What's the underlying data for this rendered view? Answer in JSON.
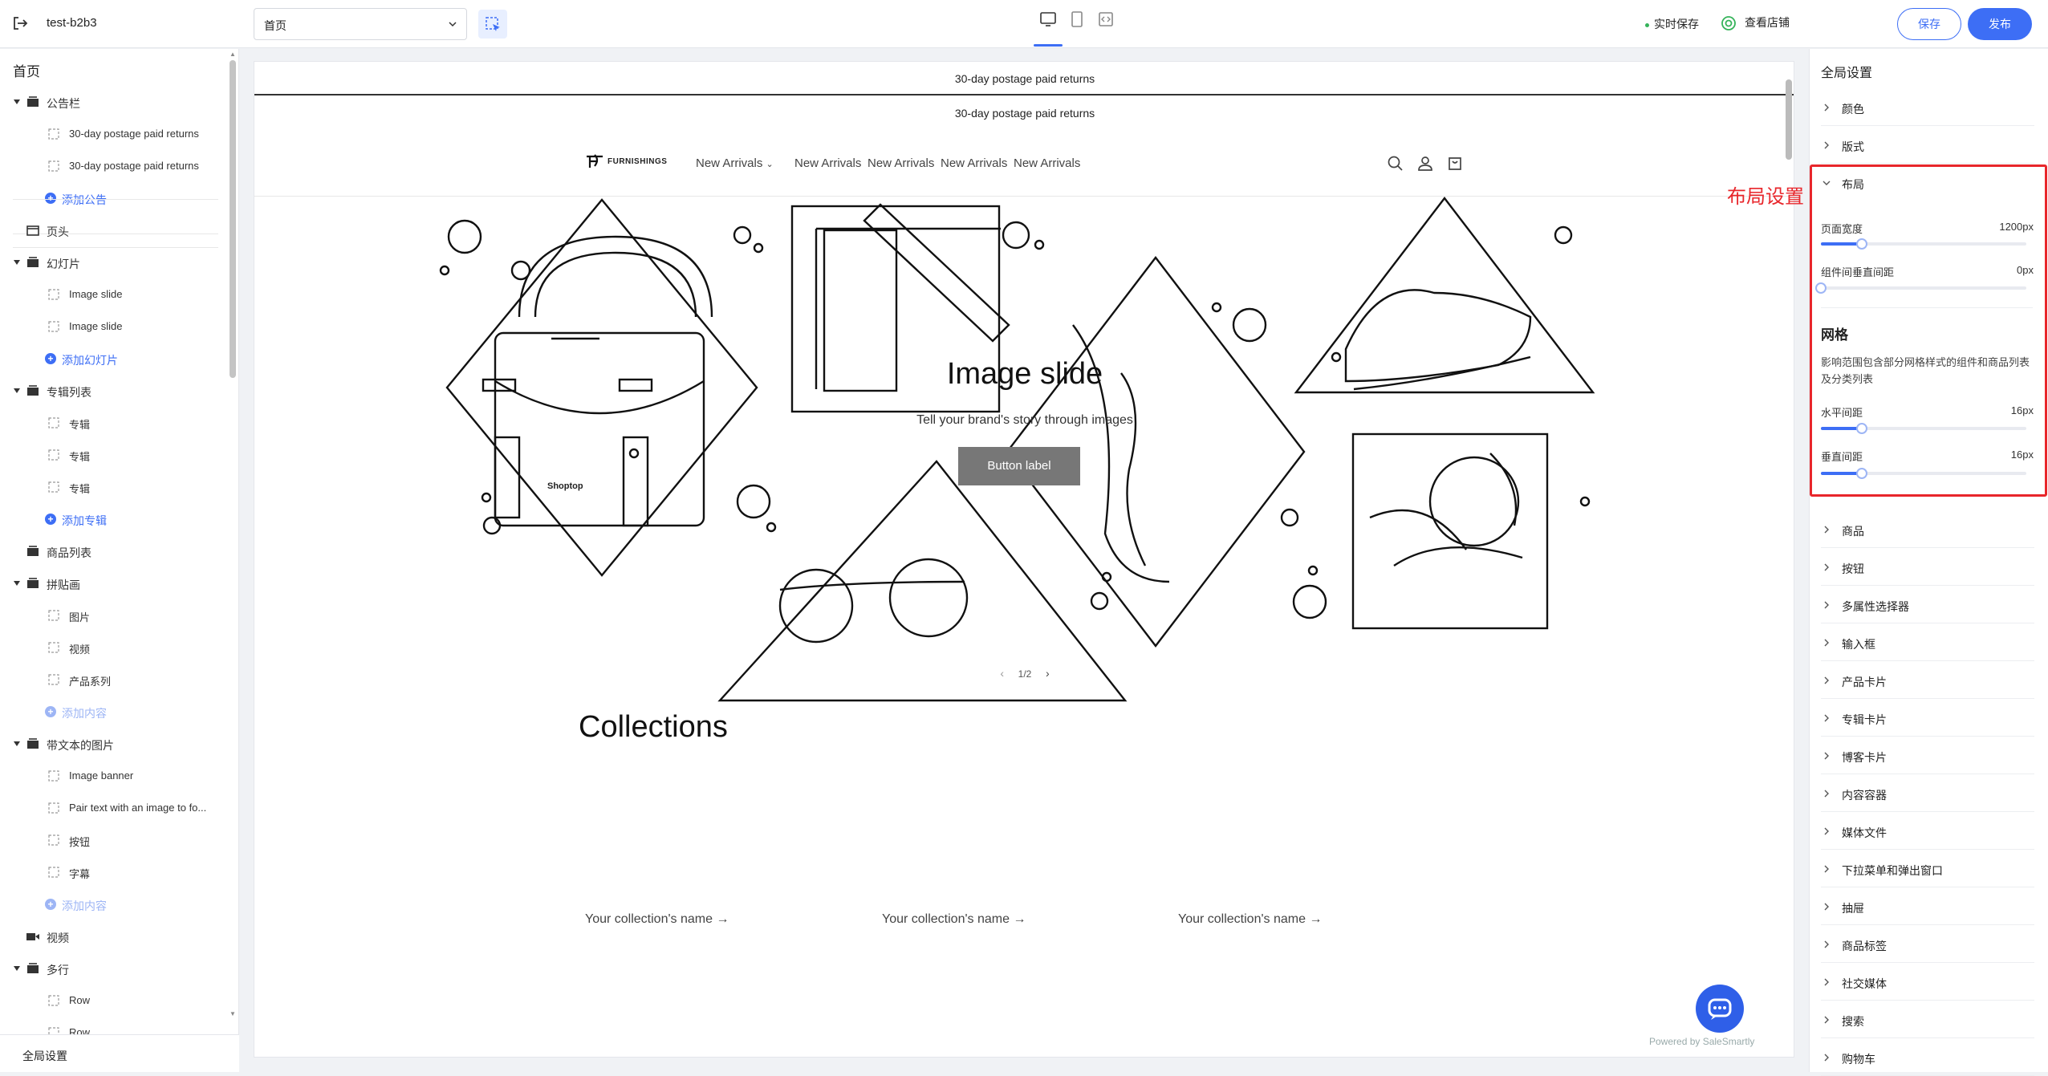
{
  "topbar": {
    "store_name": "test-b2b3",
    "page_select": "首页",
    "autosave": "实时保存",
    "view_store": "查看店铺",
    "save": "保存",
    "publish": "发布"
  },
  "left": {
    "title": "首页",
    "footer": "全局设置",
    "tree": [
      {
        "label": "公告栏",
        "type": "group"
      },
      {
        "label": "30-day postage paid returns",
        "type": "child"
      },
      {
        "label": "30-day postage paid returns",
        "type": "child"
      },
      {
        "label": "添加公告",
        "type": "add"
      },
      {
        "label": "页头",
        "type": "section"
      },
      {
        "label": "幻灯片",
        "type": "group"
      },
      {
        "label": "Image slide",
        "type": "child"
      },
      {
        "label": "Image slide",
        "type": "child"
      },
      {
        "label": "添加幻灯片",
        "type": "add"
      },
      {
        "label": "专辑列表",
        "type": "group"
      },
      {
        "label": "专辑",
        "type": "child"
      },
      {
        "label": "专辑",
        "type": "child"
      },
      {
        "label": "专辑",
        "type": "child"
      },
      {
        "label": "添加专辑",
        "type": "add"
      },
      {
        "label": "商品列表",
        "type": "section"
      },
      {
        "label": "拼贴画",
        "type": "group"
      },
      {
        "label": "图片",
        "type": "child"
      },
      {
        "label": "视频",
        "type": "child"
      },
      {
        "label": "产品系列",
        "type": "child"
      },
      {
        "label": "添加内容",
        "type": "add-disabled"
      },
      {
        "label": "带文本的图片",
        "type": "group"
      },
      {
        "label": "Image banner",
        "type": "child"
      },
      {
        "label": "Pair text with an image to fo...",
        "type": "child"
      },
      {
        "label": "按钮",
        "type": "child"
      },
      {
        "label": "字幕",
        "type": "child"
      },
      {
        "label": "添加内容",
        "type": "add-disabled"
      },
      {
        "label": "视频",
        "type": "section"
      },
      {
        "label": "多行",
        "type": "group"
      },
      {
        "label": "Row",
        "type": "child"
      },
      {
        "label": "Row",
        "type": "child"
      }
    ]
  },
  "canvas": {
    "announcement_1": "30-day postage paid returns",
    "announcement_2": "30-day postage paid returns",
    "logo_text": "FURNISHINGS",
    "nav": [
      "New Arrivals",
      "New Arrivals",
      "New Arrivals",
      "New Arrivals",
      "New Arrivals"
    ],
    "slide_title": "Image slide",
    "slide_subtitle": "Tell your brand's story through images",
    "slide_button": "Button label",
    "slide_pagination": "1/2",
    "bag_brand": "Shoptop",
    "collections_title": "Collections",
    "collection_names": [
      "Your collection's name →",
      "Your collection's name →",
      "Your collection's name →"
    ],
    "powered_by": "Powered by SaleSmartly"
  },
  "right": {
    "title": "全局设置",
    "sections_top": [
      "颜色",
      "版式"
    ],
    "layout_section": "布局",
    "page_width_label": "页面宽度",
    "page_width_value": "1200px",
    "page_width_level": 0.2,
    "component_gap_label": "组件间垂直间距",
    "component_gap_value": "0px",
    "component_gap_level": 0,
    "grid_heading": "网格",
    "grid_desc": "影响范围包含部分网格样式的组件和商品列表及分类列表",
    "h_gap_label": "水平间距",
    "h_gap_value": "16px",
    "h_gap_level": 0.2,
    "v_gap_label": "垂直间距",
    "v_gap_value": "16px",
    "v_gap_level": 0.2,
    "sections_bottom": [
      "商品",
      "按钮",
      "多属性选择器",
      "输入框",
      "产品卡片",
      "专辑卡片",
      "博客卡片",
      "内容容器",
      "媒体文件",
      "下拉菜单和弹出窗口",
      "抽屉",
      "商品标签",
      "社交媒体",
      "搜索",
      "购物车"
    ]
  },
  "annotation": "布局设置",
  "colors": {
    "accent": "#3d6ef5",
    "highlight": "#e8262b",
    "button_gray": "#777777"
  }
}
